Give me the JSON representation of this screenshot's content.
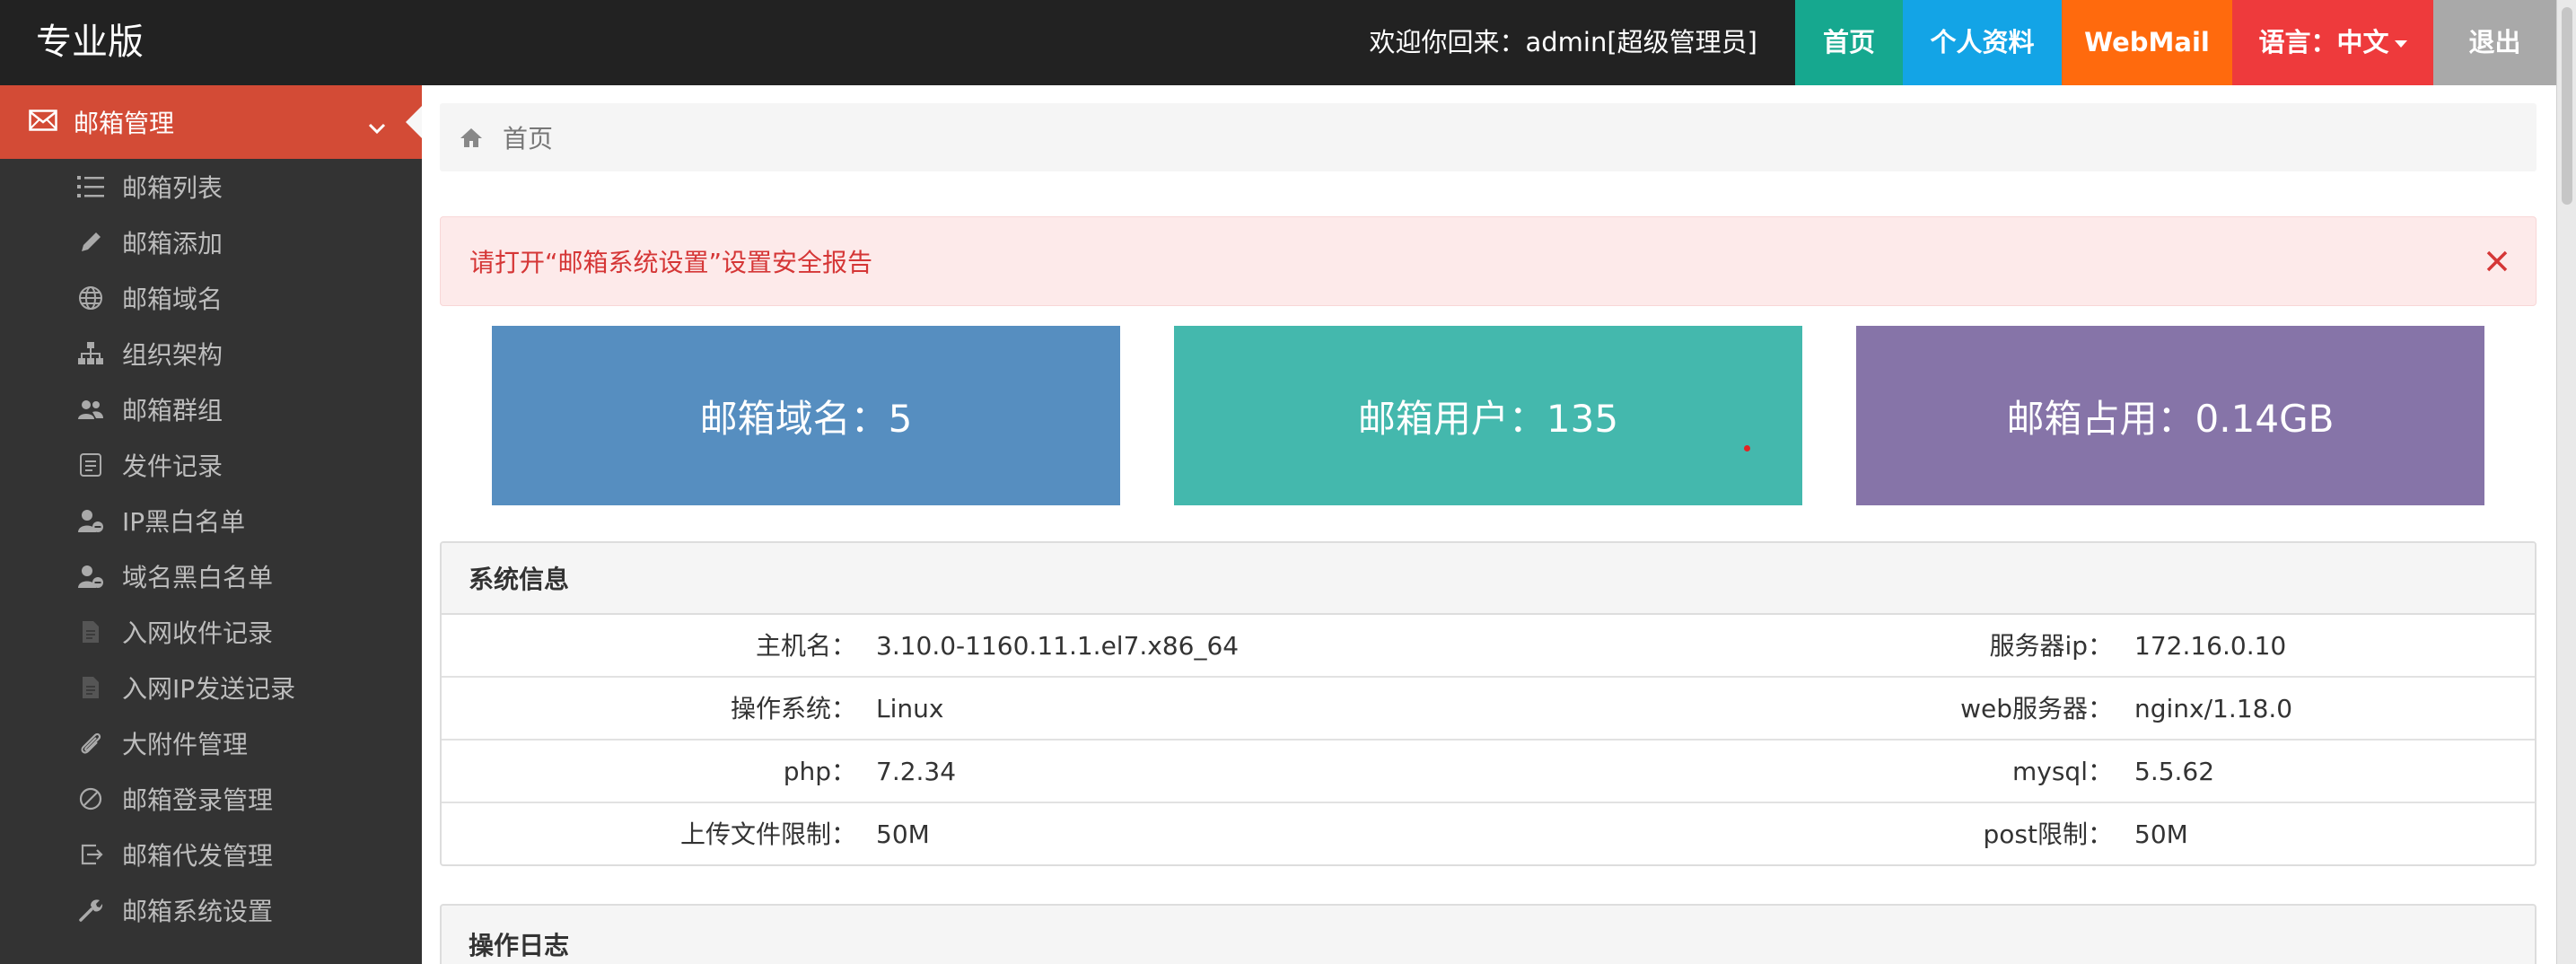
{
  "header": {
    "brand": "专业版",
    "welcome": "欢迎你回来：admin[超级管理员]",
    "nav": {
      "home": "首页",
      "profile": "个人资料",
      "webmail": "WebMail",
      "language": "语言：中文",
      "logout": "退出"
    }
  },
  "sidebar": {
    "active": "邮箱管理",
    "items": [
      {
        "label": "邮箱列表",
        "icon": "list-icon"
      },
      {
        "label": "邮箱添加",
        "icon": "pencil-icon"
      },
      {
        "label": "邮箱域名",
        "icon": "globe-icon"
      },
      {
        "label": "组织架构",
        "icon": "sitemap-icon"
      },
      {
        "label": "邮箱群组",
        "icon": "users-icon"
      },
      {
        "label": "发件记录",
        "icon": "document-icon"
      },
      {
        "label": "IP黑白名单",
        "icon": "user-minus-icon"
      },
      {
        "label": "域名黑白名单",
        "icon": "user-minus-icon"
      },
      {
        "label": "入网收件记录",
        "icon": "file-icon"
      },
      {
        "label": "入网IP发送记录",
        "icon": "file-icon"
      },
      {
        "label": "大附件管理",
        "icon": "paperclip-icon"
      },
      {
        "label": "邮箱登录管理",
        "icon": "ban-icon"
      },
      {
        "label": "邮箱代发管理",
        "icon": "forward-icon"
      },
      {
        "label": "邮箱系统设置",
        "icon": "wrench-icon"
      }
    ]
  },
  "breadcrumb": {
    "home": "首页"
  },
  "alert": {
    "message": "请打开“邮箱系统设置”设置安全报告"
  },
  "stats": {
    "domains": "邮箱域名：5",
    "users": "邮箱用户：135",
    "usage": "邮箱占用：0.14GB"
  },
  "system_info": {
    "title": "系统信息",
    "rows": [
      {
        "k1": "主机名：",
        "v1": "3.10.0-1160.11.1.el7.x86_64",
        "k2": "服务器ip：",
        "v2": "172.16.0.10"
      },
      {
        "k1": "操作系统：",
        "v1": "Linux",
        "k2": "web服务器：",
        "v2": "nginx/1.18.0"
      },
      {
        "k1": "php：",
        "v1": "7.2.34",
        "k2": "mysql：",
        "v2": "5.5.62"
      },
      {
        "k1": "上传文件限制：",
        "v1": "50M",
        "k2": "post限制：",
        "v2": "50M"
      }
    ]
  },
  "operation_log": {
    "title": "操作日志"
  }
}
